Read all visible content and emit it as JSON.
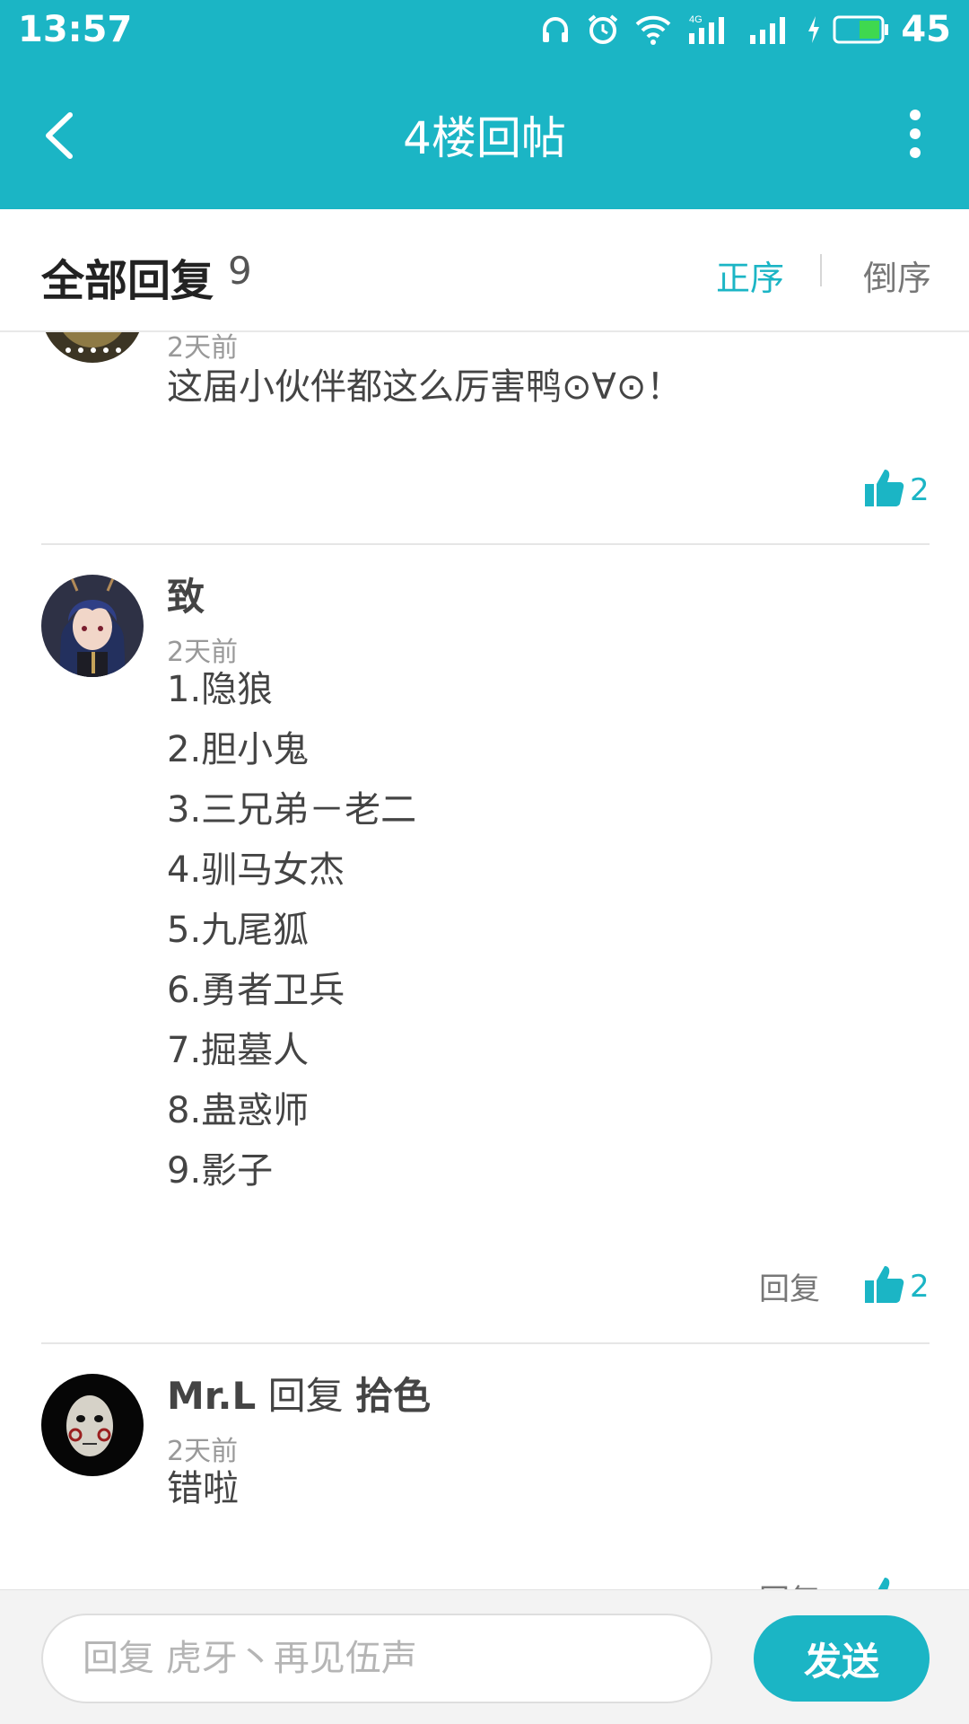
{
  "status_bar": {
    "time": "13:57",
    "network_label": "4G",
    "battery": "45",
    "icons": [
      "headphones-icon",
      "alarm-icon",
      "wifi-icon",
      "signal-4g-icon",
      "signal-icon",
      "charging-icon",
      "battery-icon"
    ]
  },
  "top_bar": {
    "title": "4楼回帖",
    "back_icon": "chevron-left-icon",
    "more_icon": "more-vertical-icon"
  },
  "replies_header": {
    "title": "全部回复",
    "count": "9",
    "sort_asc": "正序",
    "sort_desc": "倒序"
  },
  "posts": [
    {
      "time": "2天前",
      "text": "这届小伙伴都这么厉害鸭⊙∀⊙！",
      "likes": "2"
    },
    {
      "username": "致",
      "time": "2天前",
      "lines": [
        "1.隐狼",
        "2.胆小鬼",
        "3.三兄弟－老二",
        "4.驯马女杰",
        "5.九尾狐",
        "6.勇者卫兵",
        "7.掘墓人",
        "8.蛊惑师",
        "9.影子"
      ],
      "reply_label": "回复",
      "likes": "2"
    },
    {
      "username": "Mr.L",
      "reply_word": "回复",
      "reply_to": "拾色",
      "time": "2天前",
      "text": "错啦",
      "reply_label": "回复"
    }
  ],
  "bottom_bar": {
    "placeholder": "回复 虎牙丶再见伍声",
    "send_label": "发送"
  },
  "colors": {
    "accent": "#1bb5c5",
    "background": "#ffffff",
    "text": "#444444",
    "muted": "#999999"
  }
}
